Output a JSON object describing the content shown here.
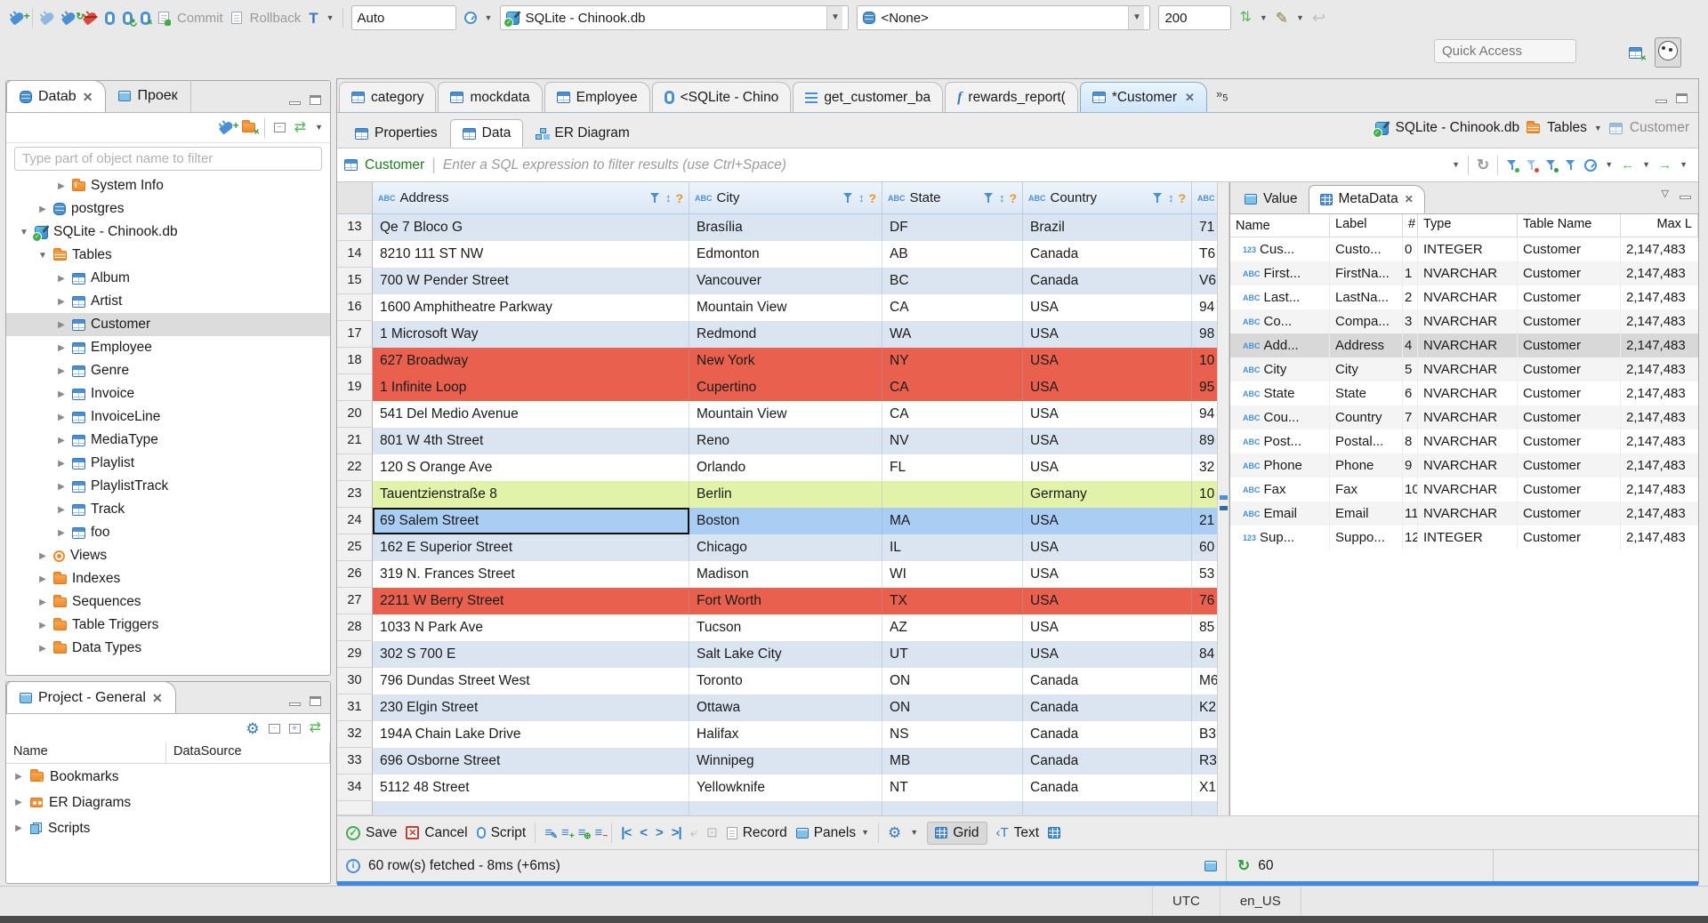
{
  "toolbar_top": {
    "commit_label": "Commit",
    "rollback_label": "Rollback",
    "auto_combo": "Auto",
    "connection_combo": "SQLite - Chinook.db",
    "schema_combo": "<None>",
    "fetch_size": "200",
    "quick_access_placeholder": "Quick Access"
  },
  "left_panel": {
    "tab_databases": "Datab",
    "tab_projects": "Проек",
    "filter_placeholder": "Type part of object name to filter",
    "tree": [
      {
        "arrow": "▶",
        "icon": "folder-info",
        "label": "System Info",
        "indent": 2
      },
      {
        "arrow": "▶",
        "icon": "db",
        "label": "postgres",
        "indent": 1
      },
      {
        "arrow": "▼",
        "icon": "sqlite",
        "label": "SQLite - Chinook.db",
        "indent": 0
      },
      {
        "arrow": "▼",
        "icon": "folder-table",
        "label": "Tables",
        "indent": 1
      },
      {
        "arrow": "▶",
        "icon": "table",
        "label": "Album",
        "indent": 2
      },
      {
        "arrow": "▶",
        "icon": "table",
        "label": "Artist",
        "indent": 2
      },
      {
        "arrow": "▶",
        "icon": "table",
        "label": "Customer",
        "indent": 2,
        "selected": true
      },
      {
        "arrow": "▶",
        "icon": "table",
        "label": "Employee",
        "indent": 2
      },
      {
        "arrow": "▶",
        "icon": "table",
        "label": "Genre",
        "indent": 2
      },
      {
        "arrow": "▶",
        "icon": "table",
        "label": "Invoice",
        "indent": 2
      },
      {
        "arrow": "▶",
        "icon": "table",
        "label": "InvoiceLine",
        "indent": 2
      },
      {
        "arrow": "▶",
        "icon": "table",
        "label": "MediaType",
        "indent": 2
      },
      {
        "arrow": "▶",
        "icon": "table",
        "label": "Playlist",
        "indent": 2
      },
      {
        "arrow": "▶",
        "icon": "table",
        "label": "PlaylistTrack",
        "indent": 2
      },
      {
        "arrow": "▶",
        "icon": "table",
        "label": "Track",
        "indent": 2
      },
      {
        "arrow": "▶",
        "icon": "table",
        "label": "foo",
        "indent": 2
      },
      {
        "arrow": "▶",
        "icon": "eye",
        "label": "Views",
        "indent": 1
      },
      {
        "arrow": "▶",
        "icon": "folder",
        "label": "Indexes",
        "indent": 1
      },
      {
        "arrow": "▶",
        "icon": "folder",
        "label": "Sequences",
        "indent": 1
      },
      {
        "arrow": "▶",
        "icon": "folder",
        "label": "Table Triggers",
        "indent": 1
      },
      {
        "arrow": "▶",
        "icon": "folder",
        "label": "Data Types",
        "indent": 1
      }
    ]
  },
  "project_panel": {
    "title": "Project - General",
    "columns": [
      "Name",
      "DataSource"
    ],
    "items": [
      {
        "icon": "bookmarks",
        "label": "Bookmarks"
      },
      {
        "icon": "er",
        "label": "ER Diagrams"
      },
      {
        "icon": "scripts",
        "label": "Scripts"
      }
    ]
  },
  "editor": {
    "tabs": [
      {
        "icon": "table",
        "label": "category"
      },
      {
        "icon": "table",
        "label": "mockdata"
      },
      {
        "icon": "table",
        "label": "Employee"
      },
      {
        "icon": "script",
        "label": "<SQLite - Chino"
      },
      {
        "icon": "sql",
        "label": "get_customer_ba"
      },
      {
        "icon": "fn",
        "label": "rewards_report("
      },
      {
        "icon": "table",
        "label": "*Customer",
        "selected": true,
        "close": true
      }
    ],
    "tab_overflow": "5",
    "subtabs": [
      {
        "icon": "table",
        "label": "Properties"
      },
      {
        "icon": "table",
        "label": "Data",
        "selected": true
      },
      {
        "icon": "diagram",
        "label": "ER Diagram"
      }
    ],
    "breadcrumb": {
      "db": "SQLite - Chinook.db",
      "group": "Tables",
      "object": "Customer"
    },
    "filter_table": "Customer",
    "filter_placeholder": "Enter a SQL expression to filter results (use Ctrl+Space)"
  },
  "grid": {
    "columns": [
      "Address",
      "City",
      "State",
      "Country"
    ],
    "rows": [
      {
        "n": "13",
        "address": "Qe 7 Bloco G",
        "city": "Brasília",
        "state": "DF",
        "country": "Brazil",
        "postal": "71",
        "hl": "blue"
      },
      {
        "n": "14",
        "address": "8210 111 ST NW",
        "city": "Edmonton",
        "state": "AB",
        "country": "Canada",
        "postal": "T6",
        "hl": "white"
      },
      {
        "n": "15",
        "address": "700 W Pender Street",
        "city": "Vancouver",
        "state": "BC",
        "country": "Canada",
        "postal": "V6",
        "hl": "blue"
      },
      {
        "n": "16",
        "address": "1600 Amphitheatre Parkway",
        "city": "Mountain View",
        "state": "CA",
        "country": "USA",
        "postal": "94",
        "hl": "white"
      },
      {
        "n": "17",
        "address": "1 Microsoft Way",
        "city": "Redmond",
        "state": "WA",
        "country": "USA",
        "postal": "98",
        "hl": "blue"
      },
      {
        "n": "18",
        "address": "627 Broadway",
        "city": "New York",
        "state": "NY",
        "country": "USA",
        "postal": "10",
        "hl": "red"
      },
      {
        "n": "19",
        "address": "1 Infinite Loop",
        "city": "Cupertino",
        "state": "CA",
        "country": "USA",
        "postal": "95",
        "hl": "red"
      },
      {
        "n": "20",
        "address": "541 Del Medio Avenue",
        "city": "Mountain View",
        "state": "CA",
        "country": "USA",
        "postal": "94",
        "hl": "white"
      },
      {
        "n": "21",
        "address": "801 W 4th Street",
        "city": "Reno",
        "state": "NV",
        "country": "USA",
        "postal": "89",
        "hl": "blue"
      },
      {
        "n": "22",
        "address": "120 S Orange Ave",
        "city": "Orlando",
        "state": "FL",
        "country": "USA",
        "postal": "32",
        "hl": "white"
      },
      {
        "n": "23",
        "address": "Tauentzienstraße 8",
        "city": "Berlin",
        "state": "",
        "country": "Germany",
        "postal": "10",
        "hl": "green"
      },
      {
        "n": "24",
        "address": "69 Salem Street",
        "city": "Boston",
        "state": "MA",
        "country": "USA",
        "postal": "21",
        "hl": "selected"
      },
      {
        "n": "25",
        "address": "162 E Superior Street",
        "city": "Chicago",
        "state": "IL",
        "country": "USA",
        "postal": "60",
        "hl": "blue"
      },
      {
        "n": "26",
        "address": "319 N. Frances Street",
        "city": "Madison",
        "state": "WI",
        "country": "USA",
        "postal": "53",
        "hl": "white"
      },
      {
        "n": "27",
        "address": "2211 W Berry Street",
        "city": "Fort Worth",
        "state": "TX",
        "country": "USA",
        "postal": "76",
        "hl": "red"
      },
      {
        "n": "28",
        "address": "1033 N Park Ave",
        "city": "Tucson",
        "state": "AZ",
        "country": "USA",
        "postal": "85",
        "hl": "white"
      },
      {
        "n": "29",
        "address": "302 S 700 E",
        "city": "Salt Lake City",
        "state": "UT",
        "country": "USA",
        "postal": "84",
        "hl": "blue"
      },
      {
        "n": "30",
        "address": "796 Dundas Street West",
        "city": "Toronto",
        "state": "ON",
        "country": "Canada",
        "postal": "M6",
        "hl": "white"
      },
      {
        "n": "31",
        "address": "230 Elgin Street",
        "city": "Ottawa",
        "state": "ON",
        "country": "Canada",
        "postal": "K2",
        "hl": "blue"
      },
      {
        "n": "32",
        "address": "194A Chain Lake Drive",
        "city": "Halifax",
        "state": "NS",
        "country": "Canada",
        "postal": "B3",
        "hl": "white"
      },
      {
        "n": "33",
        "address": "696 Osborne Street",
        "city": "Winnipeg",
        "state": "MB",
        "country": "Canada",
        "postal": "R3",
        "hl": "blue"
      },
      {
        "n": "34",
        "address": "5112 48 Street",
        "city": "Yellowknife",
        "state": "NT",
        "country": "Canada",
        "postal": "X1",
        "hl": "white"
      }
    ]
  },
  "meta_panel": {
    "tab_value": "Value",
    "tab_metadata": "MetaData",
    "columns": [
      "Name",
      "Label",
      "#",
      "Type",
      "Table Name",
      "Max L"
    ],
    "rows": [
      {
        "icon": "123",
        "name": "Cus...",
        "label": "Custo...",
        "num": "0",
        "type": "INTEGER",
        "table": "Customer",
        "max": "2,147,483"
      },
      {
        "icon": "abc",
        "name": "First...",
        "label": "FirstNa...",
        "num": "1",
        "type": "NVARCHAR",
        "table": "Customer",
        "max": "2,147,483"
      },
      {
        "icon": "abc",
        "name": "Last...",
        "label": "LastNa...",
        "num": "2",
        "type": "NVARCHAR",
        "table": "Customer",
        "max": "2,147,483"
      },
      {
        "icon": "abc",
        "name": "Co...",
        "label": "Compa...",
        "num": "3",
        "type": "NVARCHAR",
        "table": "Customer",
        "max": "2,147,483"
      },
      {
        "icon": "abc",
        "name": "Add...",
        "label": "Address",
        "num": "4",
        "type": "NVARCHAR",
        "table": "Customer",
        "max": "2,147,483",
        "selected": true
      },
      {
        "icon": "abc",
        "name": "City",
        "label": "City",
        "num": "5",
        "type": "NVARCHAR",
        "table": "Customer",
        "max": "2,147,483"
      },
      {
        "icon": "abc",
        "name": "State",
        "label": "State",
        "num": "6",
        "type": "NVARCHAR",
        "table": "Customer",
        "max": "2,147,483"
      },
      {
        "icon": "abc",
        "name": "Cou...",
        "label": "Country",
        "num": "7",
        "type": "NVARCHAR",
        "table": "Customer",
        "max": "2,147,483"
      },
      {
        "icon": "abc",
        "name": "Post...",
        "label": "Postal...",
        "num": "8",
        "type": "NVARCHAR",
        "table": "Customer",
        "max": "2,147,483"
      },
      {
        "icon": "abc",
        "name": "Phone",
        "label": "Phone",
        "num": "9",
        "type": "NVARCHAR",
        "table": "Customer",
        "max": "2,147,483"
      },
      {
        "icon": "abc",
        "name": "Fax",
        "label": "Fax",
        "num": "10",
        "type": "NVARCHAR",
        "table": "Customer",
        "max": "2,147,483"
      },
      {
        "icon": "abc",
        "name": "Email",
        "label": "Email",
        "num": "11",
        "type": "NVARCHAR",
        "table": "Customer",
        "max": "2,147,483"
      },
      {
        "icon": "123",
        "name": "Sup...",
        "label": "Suppo...",
        "num": "12",
        "type": "INTEGER",
        "table": "Customer",
        "max": "2,147,483"
      }
    ]
  },
  "bottom_toolbar": {
    "save": "Save",
    "cancel": "Cancel",
    "script": "Script",
    "record": "Record",
    "panels": "Panels",
    "grid": "Grid",
    "text": "Text"
  },
  "status": {
    "message": "60 row(s) fetched - 8ms (+6ms)",
    "refresh_count": "60"
  },
  "status_bar": {
    "timezone": "UTC",
    "locale": "en_US"
  }
}
